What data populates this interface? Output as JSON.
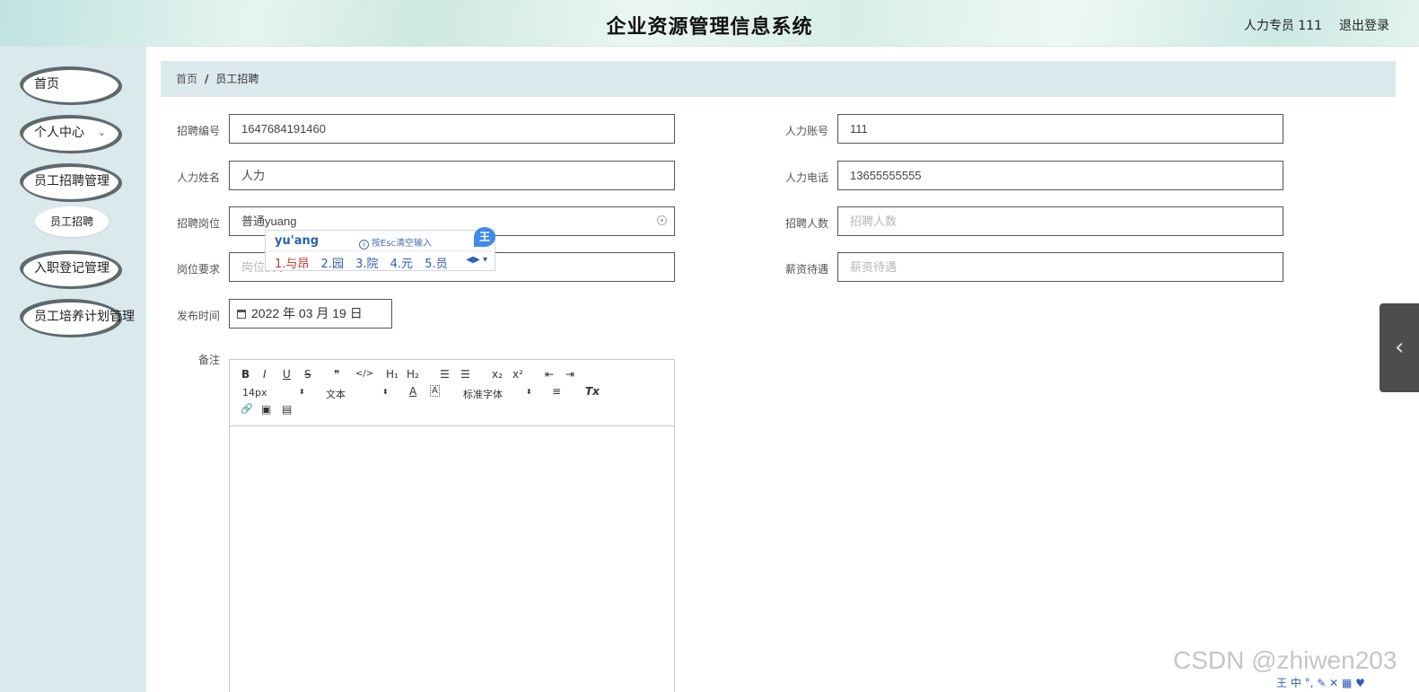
{
  "header": {
    "title": "企业资源管理信息系统",
    "user": "人力专员 111",
    "logout": "退出登录"
  },
  "sidebar": {
    "items": [
      {
        "label": "首页"
      },
      {
        "label": "个人中心",
        "chevron": "⌄"
      },
      {
        "label": "员工招聘管理"
      },
      {
        "label": "入职登记管理"
      },
      {
        "label": "员工培养计划管理"
      }
    ],
    "subitems": [
      {
        "label": "员工招聘"
      }
    ]
  },
  "breadcrumb": {
    "home": "首页",
    "separator": "/",
    "current": "员工招聘"
  },
  "form": {
    "recruit_no": {
      "label": "招聘编号",
      "value": "1647684191460"
    },
    "hr_account": {
      "label": "人力账号",
      "value": "111"
    },
    "hr_name": {
      "label": "人力姓名",
      "value": "人力"
    },
    "hr_phone": {
      "label": "人力电话",
      "value": "13655555555"
    },
    "position": {
      "label": "招聘岗位",
      "value": "普通yuang"
    },
    "headcount": {
      "label": "招聘人数",
      "placeholder": "招聘人数"
    },
    "requirements": {
      "label": "岗位要求",
      "placeholder": "岗位要求"
    },
    "salary": {
      "label": "薪资待遇",
      "placeholder": "薪资待遇"
    },
    "publish_time": {
      "label": "发布时间",
      "value": "2022 年 03 月 19 日"
    },
    "remarks": {
      "label": "备注"
    }
  },
  "ime": {
    "composition": "yu'ang",
    "hint": "按Esc清空输入",
    "candidates": [
      "1.与昂",
      "2.园",
      "3.院",
      "4.元",
      "5.员"
    ],
    "badge": "王",
    "nav": "◀▶ ▾"
  },
  "editor": {
    "toolbar": {
      "bold": "B",
      "italic": "I",
      "underline": "U",
      "strike": "S",
      "quote": "❞",
      "code": "</>",
      "h1": "H₁",
      "h2": "H₂",
      "ol": "☰",
      "ul": "☰",
      "sub": "x₂",
      "sup": "x²",
      "outdent": "⇤",
      "indent": "⇥",
      "font_size": "14px",
      "text_type": "文本",
      "color": "A",
      "background": "A",
      "font_family": "标准字体",
      "align": "≡",
      "clean": "Tx",
      "link": "🔗",
      "image": "▣",
      "video": "▤"
    }
  },
  "watermark": "CSDN @zhiwen203",
  "tray": "王 中 °, ✎ ✕ ▦ ♥"
}
